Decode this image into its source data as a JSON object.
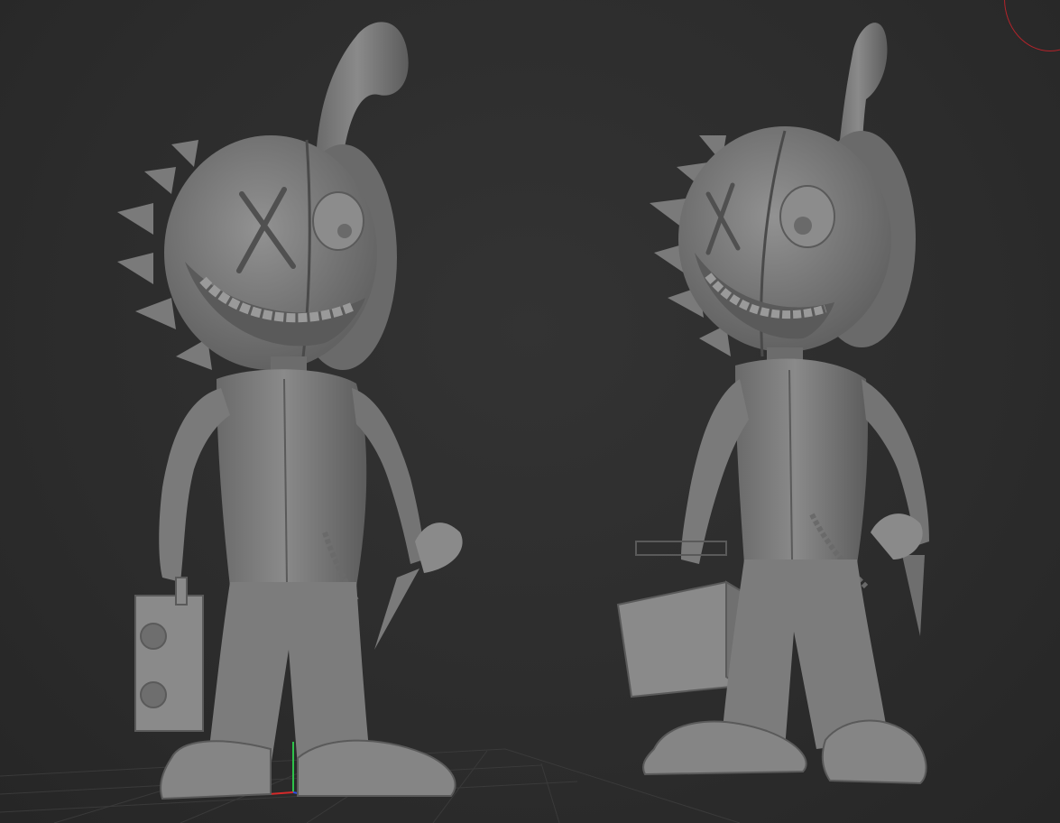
{
  "viewport": {
    "background_color": "#2b2b2b",
    "model_color": "#808080",
    "grid_color": "#3a3a3a",
    "gizmo_ring_color": "#b3232a",
    "axis_colors": {
      "x": "#d42a2a",
      "y": "#2ec24a",
      "z": "#3050e0"
    }
  },
  "models": [
    {
      "id": "figure-front",
      "holding_left": "boombox",
      "holding_right": "carrot"
    },
    {
      "id": "figure-angled",
      "holding_left": "briefcase",
      "holding_right": "carrot"
    }
  ]
}
